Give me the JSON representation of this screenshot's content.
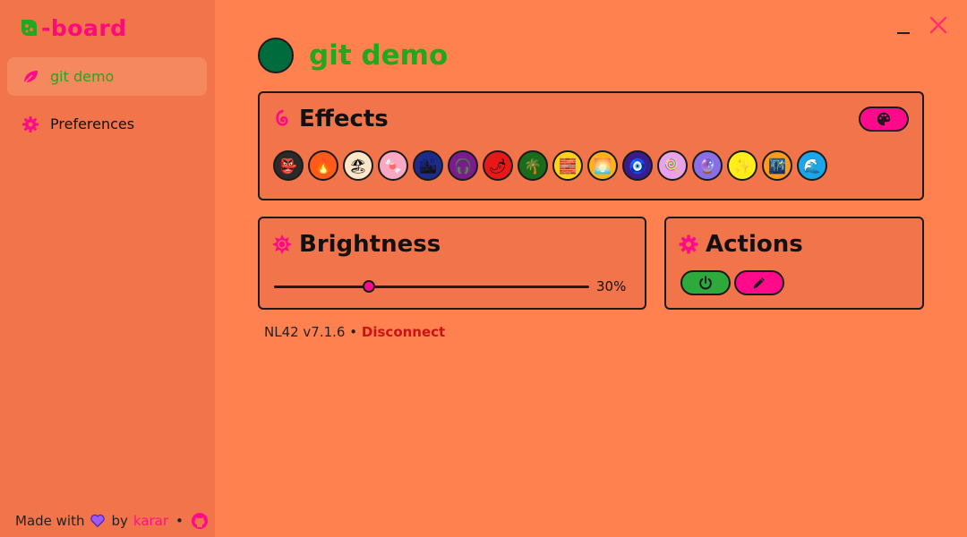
{
  "app": {
    "logo_text": "-board"
  },
  "sidebar": {
    "items": [
      {
        "label": "git demo",
        "icon": "leaf-icon",
        "active": true
      },
      {
        "label": "Preferences",
        "icon": "gear-icon",
        "active": false
      }
    ],
    "footer": {
      "made_with": "Made with",
      "by": "by",
      "author": "karar",
      "separator": "•"
    }
  },
  "device": {
    "name": "git demo",
    "color": "#006b3c"
  },
  "effects": {
    "title": "Effects",
    "items": [
      {
        "name": "mask-icon",
        "glyph": "👺",
        "bg": "#2a2a2a"
      },
      {
        "name": "fire-icon",
        "glyph": "🔥",
        "bg": "#ff5a1a"
      },
      {
        "name": "beach-icon",
        "glyph": "🏖",
        "bg": "#fde7c8"
      },
      {
        "name": "candy-icon",
        "glyph": "🍬",
        "bg": "#f7a9c4"
      },
      {
        "name": "city-icon",
        "glyph": "🏙",
        "bg": "#1d2b8a"
      },
      {
        "name": "headphones-icon",
        "glyph": "🎧",
        "bg": "#7b1c8e"
      },
      {
        "name": "chili-icon",
        "glyph": "🌶",
        "bg": "#e81818"
      },
      {
        "name": "palm-icon",
        "glyph": "🌴",
        "bg": "#1a6b1a"
      },
      {
        "name": "brick-icon",
        "glyph": "🧱",
        "bg": "#ffd21a"
      },
      {
        "name": "sunset-icon",
        "glyph": "🌅",
        "bg": "#ffb21a"
      },
      {
        "name": "eye-icon",
        "glyph": "🧿",
        "bg": "#3a1c8e"
      },
      {
        "name": "lollipop-icon",
        "glyph": "🍭",
        "bg": "#e8a2e8"
      },
      {
        "name": "crystal-icon",
        "glyph": "🔮",
        "bg": "#8a6ee8"
      },
      {
        "name": "sparkle-icon",
        "glyph": "✨",
        "bg": "#ffee1a"
      },
      {
        "name": "night-city-icon",
        "glyph": "🌃",
        "bg": "#ff9a1a"
      },
      {
        "name": "wave-icon",
        "glyph": "🌊",
        "bg": "#1aa6e8"
      }
    ]
  },
  "brightness": {
    "title": "Brightness",
    "value": 30,
    "value_label": "30%"
  },
  "actions": {
    "title": "Actions"
  },
  "status": {
    "version": "NL42 v7.1.6",
    "separator": "•",
    "disconnect": "Disconnect"
  },
  "colors": {
    "accent_pink": "#ff0a8a",
    "accent_green": "#21a81f",
    "background": "#ff8150",
    "panel": "#f1744b"
  }
}
